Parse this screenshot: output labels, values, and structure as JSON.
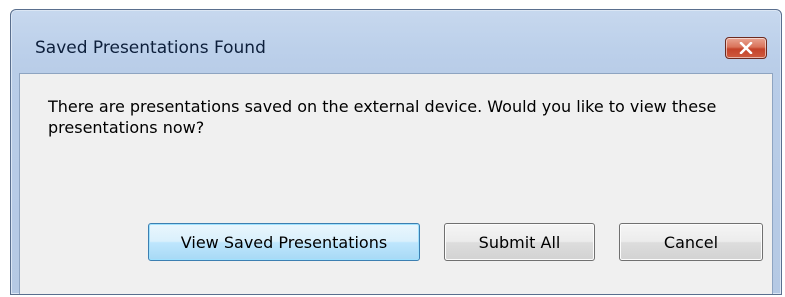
{
  "dialog": {
    "title": "Saved Presentations Found",
    "close_icon": "close-x-icon",
    "message": "There are presentations saved on the external device. Would you like to view these presentations now?",
    "buttons": {
      "view_label": "View Saved Presentations",
      "submit_label": "Submit All",
      "cancel_label": "Cancel"
    },
    "colors": {
      "close_button": "#c4432a",
      "default_button_border": "#3c7fb1",
      "client_background": "#f0f0f0"
    }
  }
}
